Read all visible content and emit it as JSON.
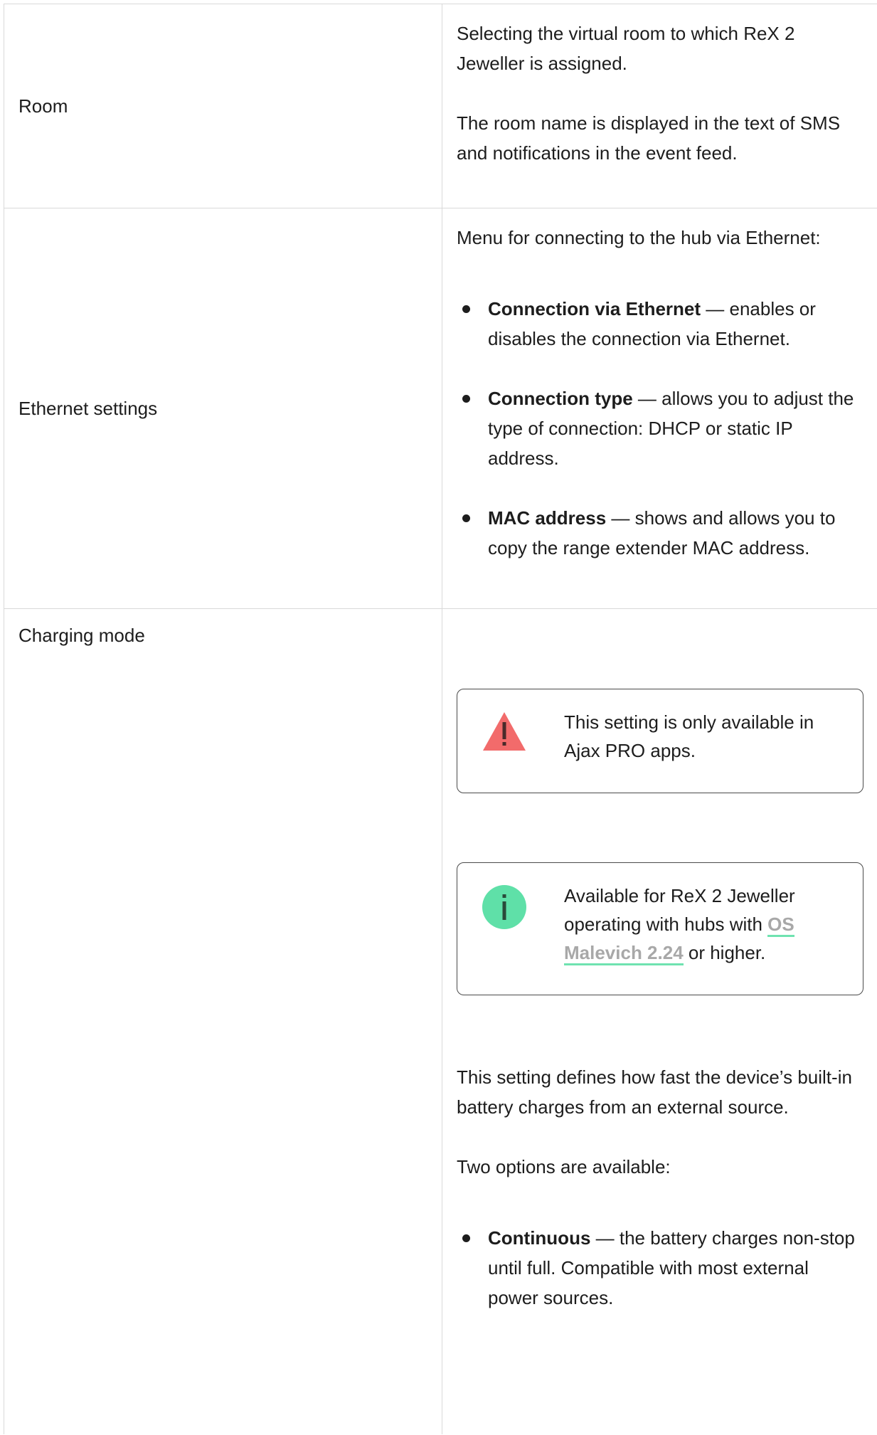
{
  "rows": [
    {
      "label": "Room",
      "paragraphs": [
        "Selecting the virtual room to which ReX 2 Jeweller is assigned.",
        "The room name is displayed in the text of SMS and notifications in the event feed."
      ]
    },
    {
      "label": "Ethernet settings",
      "intro": "Menu for connecting to the hub via Ethernet:",
      "bullets": [
        {
          "term": "Connection via Ethernet",
          "text": " — enables or disables the connection via Ethernet."
        },
        {
          "term": "Connection type",
          "text": " — allows you to adjust the type of connection: DHCP or static IP address."
        },
        {
          "term": "MAC address",
          "text": " — shows and allows you to copy the range extender MAC address."
        }
      ]
    },
    {
      "label": "Charging mode",
      "warning": {
        "icon": "warning-icon",
        "color": "#f26b6b",
        "text": "This setting is only available in Ajax PRO apps."
      },
      "info": {
        "icon": "info-icon",
        "color": "#5fe0a8",
        "text_before": "Available for ReX 2 Jeweller operating with hubs with ",
        "link": "OS Malevich 2.24",
        "text_after": " or higher."
      },
      "paragraphs": [
        "This setting defines how fast the device’s built-in battery charges from an external source.",
        "Two options are available:"
      ],
      "bullets": [
        {
          "term": "Continuous",
          "text": " — the battery charges non-stop until full. Compatible with most external power sources."
        }
      ]
    }
  ]
}
